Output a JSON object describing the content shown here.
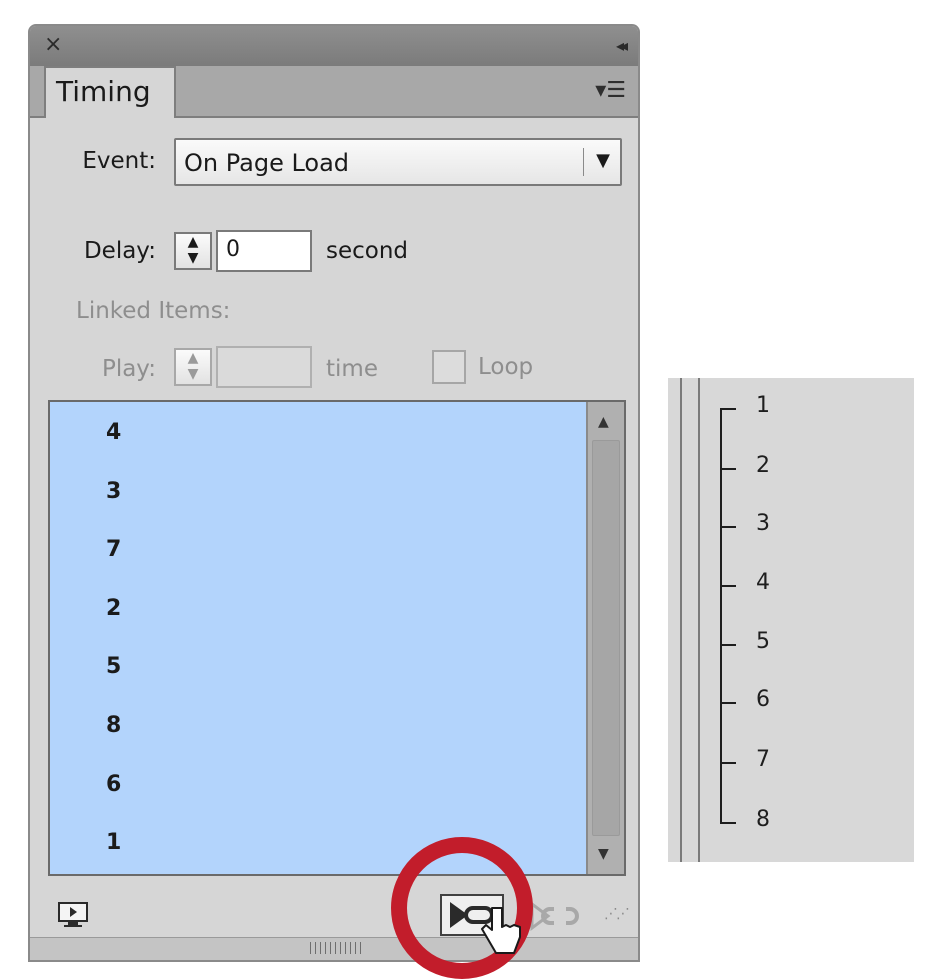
{
  "panel": {
    "tab_label": "Timing",
    "event_label": "Event:",
    "event_value": "On Page Load",
    "delay_label": "Delay:",
    "delay_value": "0",
    "delay_unit": "second",
    "linked_items_label": "Linked Items:",
    "play_label": "Play:",
    "play_value": "",
    "play_unit": "time",
    "loop_label": "Loop",
    "loop_checked": false,
    "list_items": [
      "4",
      "3",
      "7",
      "2",
      "5",
      "8",
      "6",
      "1"
    ]
  },
  "side_list": {
    "items": [
      "1",
      "2",
      "3",
      "4",
      "5",
      "6",
      "7",
      "8"
    ]
  },
  "icons": {
    "close": "close-icon",
    "collapse": "collapse-icon",
    "menu": "panel-menu-icon",
    "preview": "preview-icon",
    "link": "link-timing-icon",
    "unlink": "unlink-timing-icon"
  },
  "colors": {
    "list_background": "#b3d4fc",
    "highlight_ring": "#c21d2b"
  }
}
